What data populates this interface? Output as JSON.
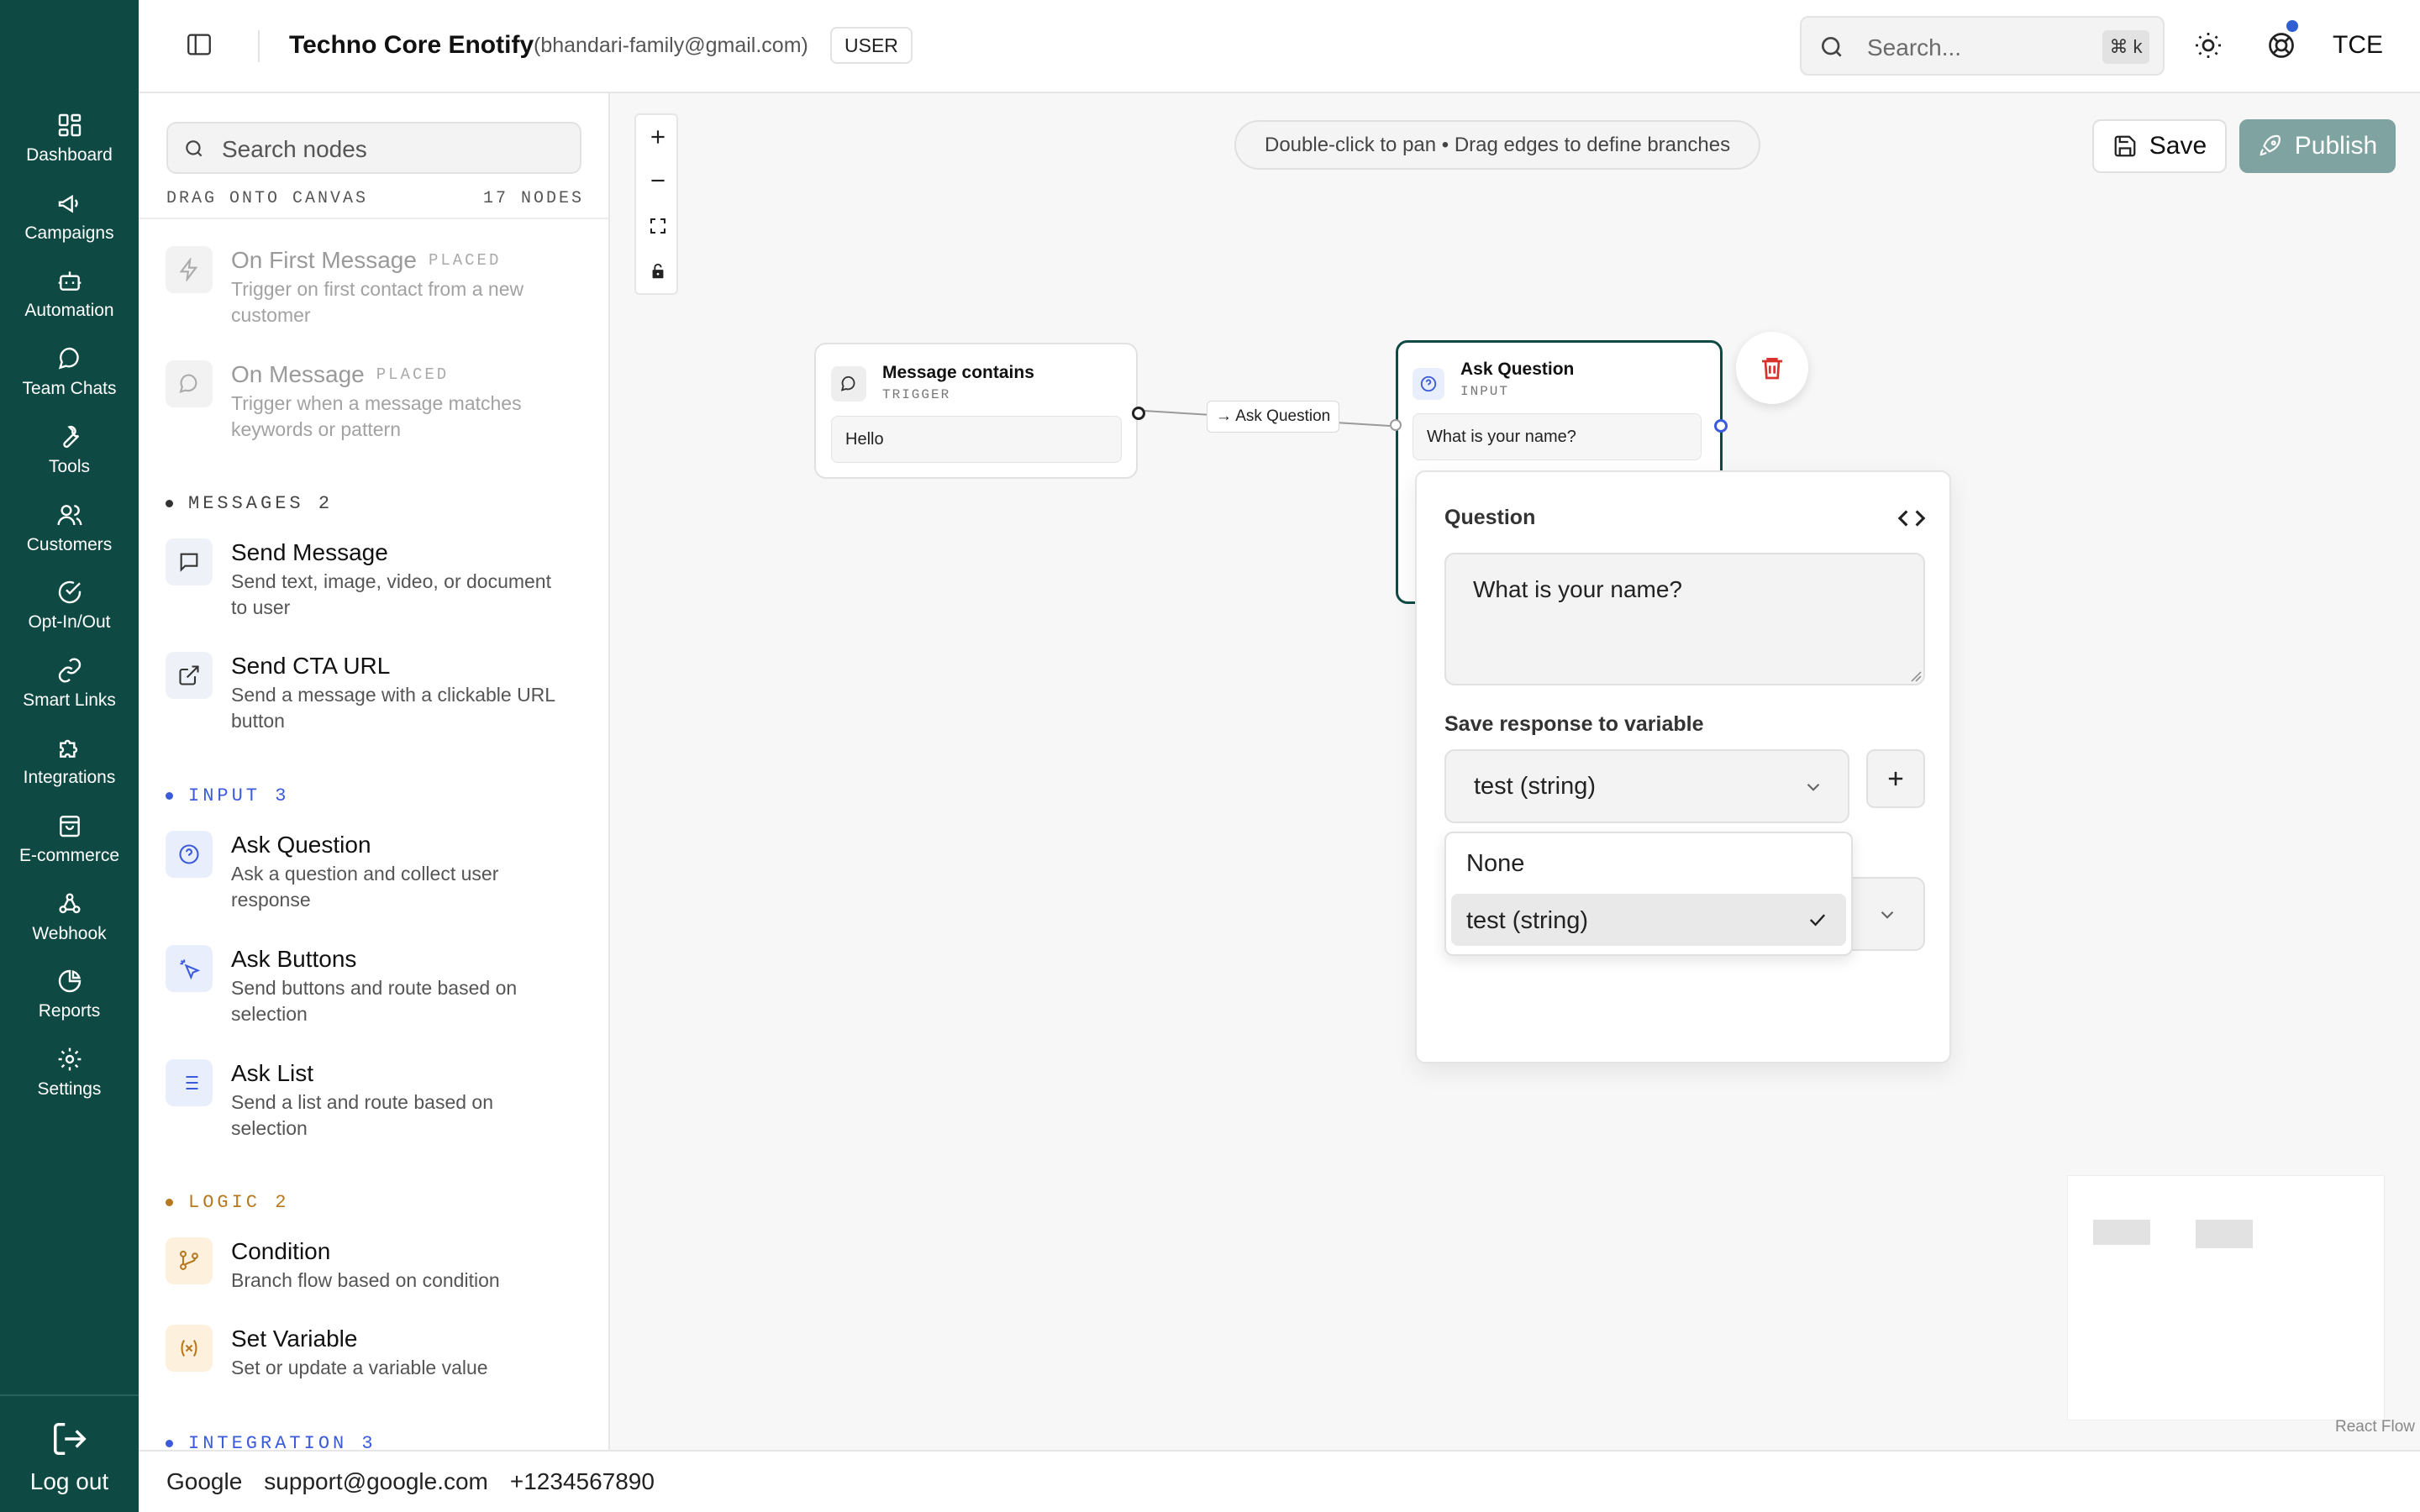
{
  "app": {
    "name": "Techno Core Enotify",
    "email": "(bhandari-family@gmail.com)",
    "role_badge": "USER",
    "search_placeholder": "Search...",
    "search_shortcut": "⌘ k",
    "avatar_initials": "TCE"
  },
  "nav": {
    "items": [
      {
        "label": "Dashboard",
        "icon": "dashboard-icon"
      },
      {
        "label": "Campaigns",
        "icon": "megaphone-icon"
      },
      {
        "label": "Automation",
        "icon": "bot-icon"
      },
      {
        "label": "Team Chats",
        "icon": "chat-icon"
      },
      {
        "label": "Tools",
        "icon": "wrench-icon"
      },
      {
        "label": "Customers",
        "icon": "users-icon"
      },
      {
        "label": "Opt-In/Out",
        "icon": "check-circle-icon"
      },
      {
        "label": "Smart Links",
        "icon": "link-icon"
      },
      {
        "label": "Integrations",
        "icon": "puzzle-icon"
      },
      {
        "label": "E-commerce",
        "icon": "shopping-bag-icon"
      },
      {
        "label": "Webhook",
        "icon": "webhook-icon"
      },
      {
        "label": "Reports",
        "icon": "pie-chart-icon"
      },
      {
        "label": "Settings",
        "icon": "gear-icon"
      }
    ],
    "logout_label": "Log out"
  },
  "palette": {
    "search_placeholder": "Search nodes",
    "drag_hint": "DRAG ONTO CANVAS",
    "node_count": "17 NODES",
    "placed_tag": "PLACED",
    "triggers": [
      {
        "title": "On First Message",
        "desc_line1": "Trigger on first contact from a new",
        "desc_line2": "customer"
      },
      {
        "title": "On Message",
        "desc_line1": "Trigger when a message matches",
        "desc_line2": "keywords or pattern"
      }
    ],
    "sections": {
      "messages": "MESSAGES 2",
      "input": "INPUT 3",
      "logic": "LOGIC 2",
      "integration": "INTEGRATION 3"
    },
    "messages": [
      {
        "title": "Send Message",
        "desc_line1": "Send text, image, video, or document",
        "desc_line2": "to user"
      },
      {
        "title": "Send CTA URL",
        "desc_line1": "Send a message with a clickable URL",
        "desc_line2": "button"
      }
    ],
    "input": [
      {
        "title": "Ask Question",
        "desc_line1": "Ask a question and collect user",
        "desc_line2": "response"
      },
      {
        "title": "Ask Buttons",
        "desc_line1": "Send buttons and route based on",
        "desc_line2": "selection"
      },
      {
        "title": "Ask List",
        "desc_line1": "Send a list and route based on",
        "desc_line2": "selection"
      }
    ],
    "logic": [
      {
        "title": "Condition",
        "desc_line1": "Branch flow based on condition"
      },
      {
        "title": "Set Variable",
        "desc_line1": "Set or update a variable value"
      }
    ]
  },
  "canvas": {
    "hint": "Double-click to pan • Drag edges to define branches",
    "save_label": "Save",
    "publish_label": "Publish",
    "edge_label": "→ Ask Question",
    "attribution": "React Flow",
    "trigger_node": {
      "title": "Message contains",
      "type": "TRIGGER",
      "value": "Hello"
    },
    "question_node": {
      "title": "Ask Question",
      "type": "INPUT",
      "value": "What is your name?"
    }
  },
  "editor": {
    "question_label": "Question",
    "question_value": "What is your name?",
    "variable_label": "Save response to variable",
    "selected_variable": "test (string)",
    "options": [
      "None",
      "test (string)"
    ]
  },
  "footer": {
    "company": "Google",
    "email": "support@google.com",
    "phone": "+1234567890"
  },
  "colors": {
    "rail_bg": "#0e4a43",
    "accent_blue": "#3b5bdb",
    "logic_amber": "#b7791f",
    "publish_bg": "#7fa3a0",
    "delete_red": "#d9312b"
  }
}
